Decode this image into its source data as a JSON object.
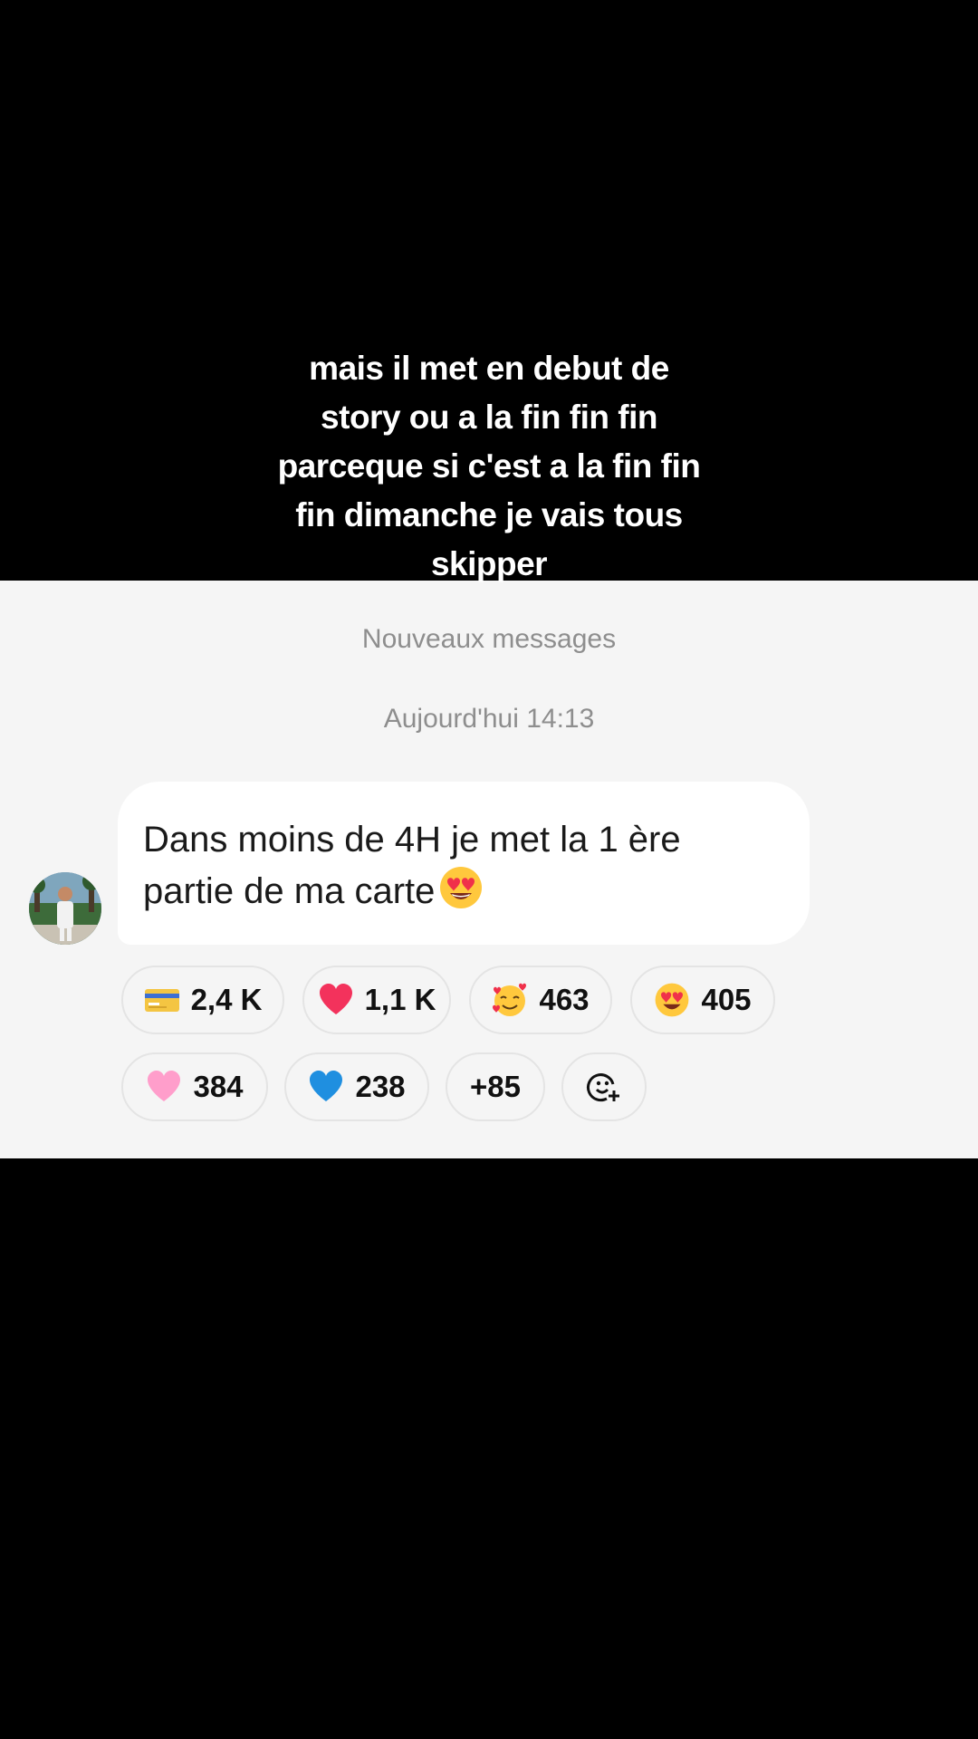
{
  "caption": {
    "lines": [
      "mais il met en debut de",
      "story ou a la fin fin fin",
      "parceque si c'est a la fin fin",
      "fin dimanche je vais tous",
      "skipper"
    ]
  },
  "chat": {
    "divider": "Nouveaux messages",
    "timestamp": "Aujourd'hui 14:13",
    "message": {
      "line1": "Dans moins de 4H je met la 1 ère",
      "line2": "partie de ma carte",
      "emoji": "heart-eyes-emoji"
    },
    "reactions": [
      {
        "emoji": "credit-card-emoji",
        "count": "2,4 K"
      },
      {
        "emoji": "red-heart-emoji",
        "count": "1,1 K"
      },
      {
        "emoji": "smiling-face-with-hearts-emoji",
        "count": "463"
      },
      {
        "emoji": "heart-eyes-emoji",
        "count": "405"
      },
      {
        "emoji": "pink-heart-emoji",
        "count": "384"
      },
      {
        "emoji": "blue-heart-emoji",
        "count": "238"
      },
      {
        "emoji": "",
        "count": "+85"
      },
      {
        "emoji": "add-reaction-icon",
        "count": ""
      }
    ]
  },
  "colors": {
    "background": "#000000",
    "panel": "#f5f5f5",
    "bubble": "#ffffff",
    "muted_text": "#8e8e8e"
  }
}
